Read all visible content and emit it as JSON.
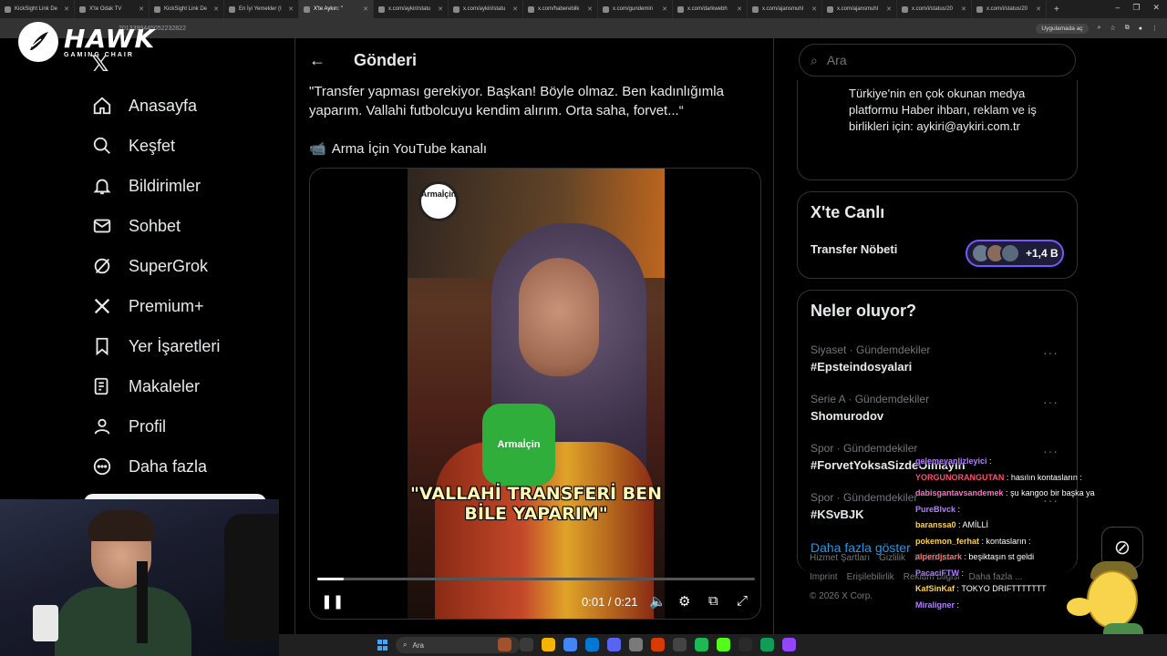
{
  "browser": {
    "tabs": [
      {
        "label": "KickSight Link De"
      },
      {
        "label": "X'te Odak TV"
      },
      {
        "label": "KickSight Link De"
      },
      {
        "label": "En İyi Yemekler (I"
      },
      {
        "label": "X'te Aykırı: \""
      },
      {
        "label": "x.com/aykiri/statu"
      },
      {
        "label": "x.com/aykiri/statu"
      },
      {
        "label": "x.com/haberebilk"
      },
      {
        "label": "x.com/gundemin"
      },
      {
        "label": "x.com/darkwebh"
      },
      {
        "label": "x.com/ajansmuhl"
      },
      {
        "label": "x.com/ajansmuhl"
      },
      {
        "label": "x.com/i/status/20"
      },
      {
        "label": "x.com/i/status/20"
      }
    ],
    "active_tab_index": 4,
    "url": "2013399445052232822",
    "app_button": "Uygulamada aç"
  },
  "branding": {
    "title": "HAWK",
    "subtitle": "GAMING CHAIR"
  },
  "nav": {
    "items": [
      {
        "label": "Anasayfa",
        "icon": "home-icon"
      },
      {
        "label": "Keşfet",
        "icon": "search-icon"
      },
      {
        "label": "Bildirimler",
        "icon": "bell-icon"
      },
      {
        "label": "Sohbet",
        "icon": "mail-icon"
      },
      {
        "label": "SuperGrok",
        "icon": "grok-icon"
      },
      {
        "label": "Premium+",
        "icon": "x-icon"
      },
      {
        "label": "Yer İşaretleri",
        "icon": "bookmark-icon"
      },
      {
        "label": "Makaleler",
        "icon": "article-icon"
      },
      {
        "label": "Profil",
        "icon": "user-icon"
      },
      {
        "label": "Daha fazla",
        "icon": "more-circle-icon"
      }
    ]
  },
  "post": {
    "header_title": "Gönderi",
    "text": "\"Transfer yapması gerekiyor. Başkan! Böyle olmaz. Ben kadınlığımla yaparım. Vallahi futbolcuyu kendim alırım. Orta saha, forvet...“",
    "youtube_line": "Arma İçin YouTube kanalı",
    "video": {
      "caption": "\"VALLAHİ TRANSFERİ BEN BİLE YAPARIM\"",
      "watermark": "Armaİçin",
      "mic_label": "Armaİçin",
      "current_time": "0:01",
      "duration": "0:21",
      "time_display": "0:01 / 0:21",
      "progress_fraction": 0.06
    }
  },
  "right": {
    "search_placeholder": "Ara",
    "bio": "Türkiye'nin en çok okunan medya platformu Haber ihbarı, reklam ve iş birlikleri için: aykiri@aykiri.com.tr",
    "live": {
      "title": "X'te Canlı",
      "name": "Transfer Nöbeti",
      "count": "+1,4 B"
    },
    "trends": {
      "title": "Neler oluyor?",
      "items": [
        {
          "meta": "Siyaset · Gündemdekiler",
          "name": "#Epsteindosyalari"
        },
        {
          "meta": "Serie A · Gündemdekiler",
          "name": "Shomurodov"
        },
        {
          "meta": "Spor · Gündemdekiler",
          "name": "#ForvetYoksaSizdeOlmayın"
        },
        {
          "meta": "Spor · Gündemdekiler",
          "name": "#KSvBJK"
        }
      ],
      "show_more": "Daha fazla göster"
    },
    "footer": {
      "line1": [
        "Hizmet Şartları",
        "Gizlilik",
        "Politikası"
      ],
      "line2": [
        "Imprint",
        "Erişilebilirlik",
        "Reklam bilgisi",
        "Daha fazla ..."
      ],
      "copyright": "© 2026 X Corp."
    }
  },
  "chat": {
    "messages": [
      {
        "user": "gelemeyanlizleyici",
        "msg": "",
        "color": "#b27dff"
      },
      {
        "user": "YORGUNORANGUTAN",
        "msg": "hasılın kontasların :",
        "color": "#ff4d6d"
      },
      {
        "user": "dabisgantavsandemek",
        "msg": "şu kangoo bir başka ya",
        "color": "#ff6ec7"
      },
      {
        "user": "PureBlvck",
        "msg": "",
        "color": "#b27dff"
      },
      {
        "user": "baranssa0",
        "msg": "AMİLLİ",
        "color": "#ffd24d"
      },
      {
        "user": "pokemon_ferhat",
        "msg": "kontasların :",
        "color": "#ffd24d"
      },
      {
        "user": "alperdjstark",
        "msg": "beşiktaşın st geldi",
        "color": "#ff6e6e"
      },
      {
        "user": "PacaciFTW",
        "msg": "",
        "color": "#b27dff"
      },
      {
        "user": "KafSinKaf",
        "msg": "TOKYO DRIFTTTTTTT",
        "color": "#ffd24d"
      },
      {
        "user": "Miraligner",
        "msg": "",
        "color": "#b27dff"
      }
    ]
  },
  "taskbar": {
    "search_placeholder": "Ara"
  },
  "colors": {
    "accent": "#1d9bf0",
    "background": "#000000",
    "border": "#2f3336",
    "live_border": "#7856ff"
  }
}
